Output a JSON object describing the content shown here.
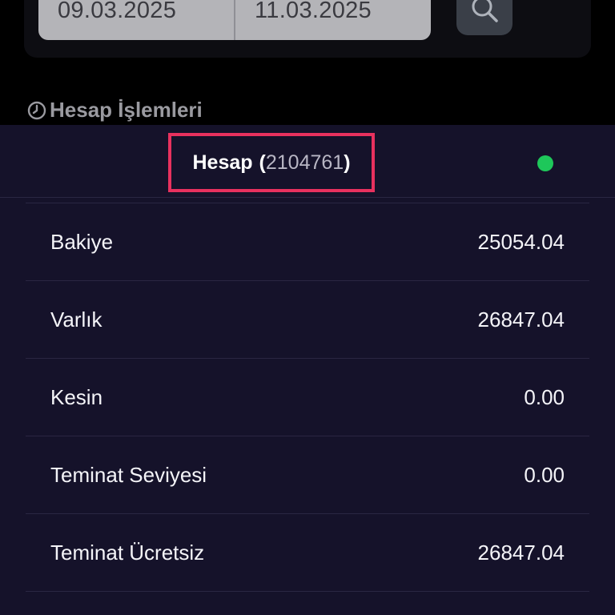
{
  "filter": {
    "start_date": "09.03.2025",
    "end_date": "11.03.2025",
    "search_icon": "search-icon"
  },
  "section": {
    "title": "Hesap İşlemleri",
    "icon": "clock-icon"
  },
  "account": {
    "label": "Hesap",
    "open_paren": "(",
    "number": "2104761",
    "close_paren": ")",
    "status_color": "#1ec75a"
  },
  "rows": [
    {
      "label": "Bakiye",
      "value": "25054.04"
    },
    {
      "label": "Varlık",
      "value": "26847.04"
    },
    {
      "label": "Kesin",
      "value": "0.00"
    },
    {
      "label": "Teminat Seviyesi",
      "value": "0.00"
    },
    {
      "label": "Teminat Ücretsiz",
      "value": "26847.04"
    }
  ],
  "colors": {
    "highlight_border": "#e8315e",
    "panel_bg": "#15122a"
  }
}
